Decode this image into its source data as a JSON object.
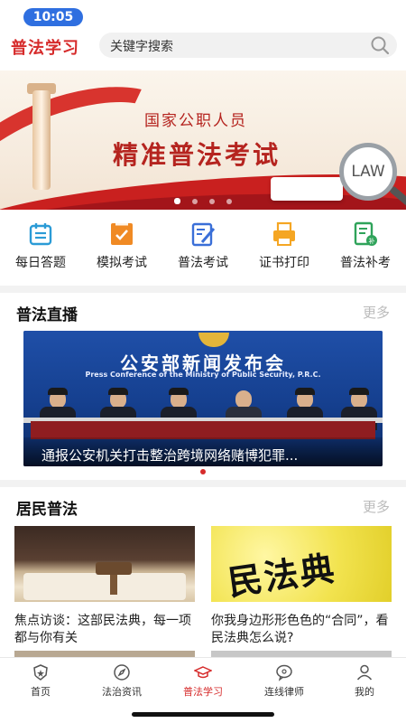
{
  "status": {
    "time": "10:05"
  },
  "header": {
    "title": "普法学习",
    "search_placeholder": "关键字搜索"
  },
  "banner": {
    "line1": "国家公职人员",
    "line2": "精准普法考试",
    "badge": "LAW",
    "dots_count": 4,
    "active_dot": 1
  },
  "menu": [
    {
      "label": "每日答题",
      "icon": "calendar-icon",
      "color": "#2b9bd6"
    },
    {
      "label": "模拟考试",
      "icon": "checklist-icon",
      "color": "#f08a24"
    },
    {
      "label": "普法考试",
      "icon": "edit-paper-icon",
      "color": "#3a6fd8"
    },
    {
      "label": "证书打印",
      "icon": "printer-icon",
      "color": "#f5a623"
    },
    {
      "label": "普法补考",
      "icon": "retake-exam-icon",
      "color": "#2fa35a"
    }
  ],
  "live": {
    "section_title": "普法直播",
    "more": "更多",
    "card_heading": "公安部新闻发布会",
    "card_subheading": "Press Conference of the Ministry of Public Security, P.R.C.",
    "caption": "通报公安机关打击整治跨境网络赌博犯罪..."
  },
  "resident": {
    "section_title": "居民普法",
    "more": "更多",
    "articles": [
      {
        "title": "焦点访谈：这部民法典，每一项都与你有关"
      },
      {
        "title": "你我身边形形色色的“合同”，看民法典怎么说?",
        "image_text": "民法典"
      }
    ]
  },
  "tabbar": {
    "active_index": 2,
    "accent": "#d62b2b",
    "tabs": [
      {
        "label": "首页",
        "icon": "home-shield-icon"
      },
      {
        "label": "法治资讯",
        "icon": "compass-icon"
      },
      {
        "label": "普法学习",
        "icon": "graduation-cap-icon"
      },
      {
        "label": "连线律师",
        "icon": "chat-bubble-icon"
      },
      {
        "label": "我的",
        "icon": "user-icon"
      }
    ]
  }
}
